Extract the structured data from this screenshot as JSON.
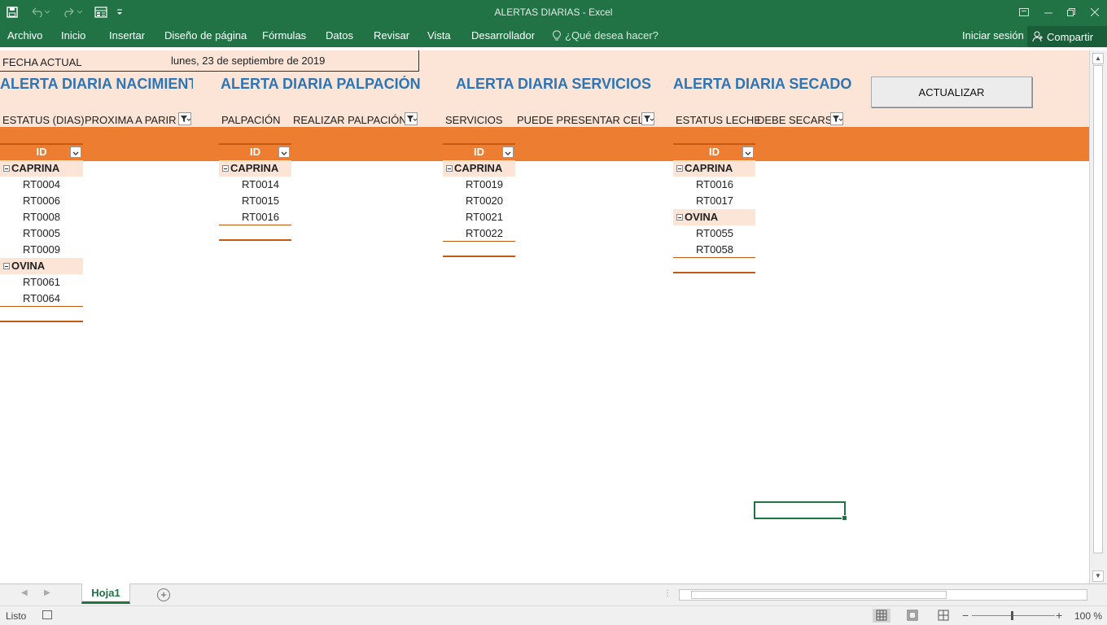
{
  "window": {
    "title": "ALERTAS DIARIAS - Excel"
  },
  "ribbon": {
    "tabs": [
      "Archivo",
      "Inicio",
      "Insertar",
      "Diseño de página",
      "Fórmulas",
      "Datos",
      "Revisar",
      "Vista",
      "Desarrollador"
    ],
    "tell_me": "¿Qué desea hacer?",
    "sign_in": "Iniciar sesión",
    "share": "Compartir"
  },
  "sheet": {
    "fecha_label": "FECHA ACTUAL",
    "fecha_value": "lunes, 23 de septiembre de 2019",
    "alerts": [
      {
        "title": "ALERTA DIARIA NACIMIENTOS",
        "col1": "ESTATUS (DIAS)",
        "col2": "PROXIMA A PARIR"
      },
      {
        "title": "ALERTA DIARIA PALPACIÓN",
        "col1": "PALPACIÓN",
        "col2": "REALIZAR PALPACIÓN"
      },
      {
        "title": "ALERTA DIARIA SERVICIOS",
        "col1": "SERVICIOS",
        "col2": "PUEDE PRESENTAR CELO"
      },
      {
        "title": "ALERTA DIARIA SECADO",
        "col1": "ESTATUS LECHE",
        "col2": "DEBE SECARSE"
      }
    ],
    "button": "ACTUALIZAR",
    "id_header": "ID",
    "pivots": [
      {
        "groups": [
          {
            "name": "CAPRINA",
            "items": [
              "RT0004",
              "RT0006",
              "RT0008",
              "RT0005",
              "RT0009"
            ]
          },
          {
            "name": "OVINA",
            "items": [
              "RT0061",
              "RT0064"
            ]
          }
        ]
      },
      {
        "groups": [
          {
            "name": "CAPRINA",
            "items": [
              "RT0014",
              "RT0015",
              "RT0016"
            ]
          }
        ]
      },
      {
        "groups": [
          {
            "name": "CAPRINA",
            "items": [
              "RT0019",
              "RT0020",
              "RT0021",
              "RT0022"
            ]
          }
        ]
      },
      {
        "groups": [
          {
            "name": "CAPRINA",
            "items": [
              "RT0016",
              "RT0017"
            ]
          },
          {
            "name": "OVINA",
            "items": [
              "RT0055",
              "RT0058"
            ]
          }
        ]
      }
    ]
  },
  "sheet_tab": "Hoja1",
  "status": {
    "ready": "Listo",
    "zoom": "100 %"
  },
  "colors": {
    "excel_green": "#217346",
    "peach": "#fce4d6",
    "orange": "#ed7d31",
    "title_blue": "#2e75b6"
  }
}
